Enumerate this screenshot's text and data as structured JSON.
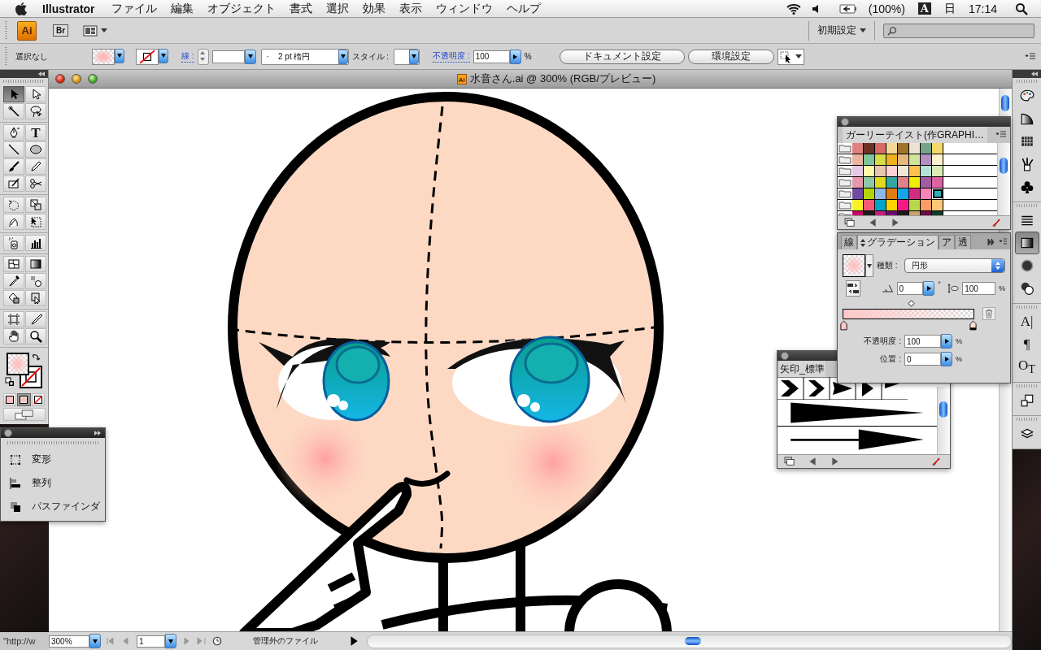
{
  "menu_bar": {
    "app_name": "Illustrator",
    "menus": [
      "ファイル",
      "編集",
      "オブジェクト",
      "書式",
      "選択",
      "効果",
      "表示",
      "ウィンドウ",
      "ヘルプ"
    ],
    "battery": "(100%)",
    "input_source": "A",
    "day": "日",
    "time": "17:14"
  },
  "app_bar": {
    "app_logo": "Ai",
    "bridge_logo": "Br",
    "workspace": "初期設定"
  },
  "control_bar": {
    "selection": "選択なし",
    "stroke_label": "線 :",
    "stroke_profile": "·    2 pt 楕円",
    "style_label": "スタイル :",
    "opacity_label": "不透明度 :",
    "opacity": "100",
    "opacity_unit": "%",
    "buttons": [
      "ドキュメント設定",
      "環境設定"
    ]
  },
  "document": {
    "title": "水音さん.ai @ 300% (RGB/プレビュー)",
    "file_icon": "Ai"
  },
  "tool_groups": [
    {
      "tools": [
        {
          "kind": "selection",
          "selected": true
        },
        {
          "kind": "direct-selection",
          "selected": false
        },
        {
          "kind": "magic-wand",
          "selected": false
        },
        {
          "kind": "lasso",
          "selected": false
        }
      ]
    },
    {
      "tools": [
        {
          "kind": "pen",
          "selected": false
        },
        {
          "kind": "type",
          "glyph": "T",
          "selected": false
        },
        {
          "kind": "line",
          "selected": false
        },
        {
          "kind": "ellipse",
          "selected": false
        },
        {
          "kind": "paintbrush",
          "selected": false
        },
        {
          "kind": "pencil",
          "selected": false
        },
        {
          "kind": "eraser",
          "selected": false
        },
        {
          "kind": "scissors",
          "selected": false
        }
      ]
    },
    {
      "tools": [
        {
          "kind": "rotate",
          "selected": false
        },
        {
          "kind": "scale",
          "selected": false
        },
        {
          "kind": "warp",
          "selected": false
        },
        {
          "kind": "free-transform",
          "selected": false
        }
      ]
    },
    {
      "tools": [
        {
          "kind": "sprayer",
          "selected": false
        },
        {
          "kind": "graph",
          "selected": false
        }
      ]
    },
    {
      "tools": [
        {
          "kind": "mesh",
          "selected": false
        },
        {
          "kind": "gradient",
          "selected": false
        },
        {
          "kind": "eyedropper",
          "selected": false
        },
        {
          "kind": "blend",
          "selected": false
        },
        {
          "kind": "live-paint",
          "selected": false
        },
        {
          "kind": "live-paint-select",
          "selected": false
        }
      ]
    },
    {
      "tools": [
        {
          "kind": "crop",
          "selected": false
        },
        {
          "kind": "slice",
          "selected": false
        },
        {
          "kind": "hand",
          "selected": false
        },
        {
          "kind": "zoom",
          "selected": false
        }
      ]
    }
  ],
  "color_modes": [
    {
      "kind": "color",
      "selected": false
    },
    {
      "kind": "gradient",
      "selected": true
    },
    {
      "kind": "none",
      "selected": false
    }
  ],
  "dock_groups": [
    {
      "icons": [
        {
          "kind": "color",
          "selected": false
        },
        {
          "kind": "color-guide",
          "selected": false
        },
        {
          "kind": "swatches",
          "selected": false
        },
        {
          "kind": "brushes",
          "selected": false
        },
        {
          "kind": "symbols",
          "selected": false
        }
      ]
    },
    {
      "icons": [
        {
          "kind": "stroke",
          "selected": false
        },
        {
          "kind": "gradient",
          "selected": true
        },
        {
          "kind": "transparency",
          "selected": false
        },
        {
          "kind": "appearance",
          "selected": false
        }
      ]
    },
    {
      "icons": [
        {
          "kind": "character",
          "glyph": "A|",
          "selected": false
        },
        {
          "kind": "paragraph",
          "glyph": "¶",
          "selected": false
        },
        {
          "kind": "opentype",
          "glyph": "O$_{T}$",
          "selected": false
        }
      ]
    },
    {
      "icons": [
        {
          "kind": "transform",
          "selected": false
        }
      ]
    },
    {
      "icons": [
        {
          "kind": "layers",
          "selected": false
        }
      ]
    }
  ],
  "swatches_panel": {
    "title": "ガーリーテイスト(作GRAPHI…",
    "rows": [
      {
        "swatches": [
          {
            "color": "#e08080",
            "selected": false
          },
          {
            "color": "#6b3326",
            "selected": false
          },
          {
            "color": "#d96868",
            "selected": false
          },
          {
            "color": "#f5d89a",
            "selected": false
          },
          {
            "color": "#a07428",
            "selected": false
          },
          {
            "color": "#ede3d3",
            "selected": false
          },
          {
            "color": "#76a38a",
            "selected": false
          },
          {
            "color": "#f5d86a",
            "selected": false
          }
        ]
      },
      {
        "swatches": [
          {
            "color": "#e8b4a0",
            "selected": false
          },
          {
            "color": "#80c49a",
            "selected": false
          },
          {
            "color": "#d6dc46",
            "selected": false
          },
          {
            "color": "#ecb21e",
            "selected": false
          },
          {
            "color": "#e6b87e",
            "selected": false
          },
          {
            "color": "#d2e39c",
            "selected": false
          },
          {
            "color": "#b48ec0",
            "selected": false
          },
          {
            "color": "#fff3cc",
            "selected": false
          }
        ]
      },
      {
        "swatches": [
          {
            "color": "#e6c8e4",
            "selected": false
          },
          {
            "color": "#fffaa8",
            "selected": false
          },
          {
            "color": "#e6c6ae",
            "selected": false
          },
          {
            "color": "#ffd0d4",
            "selected": false
          },
          {
            "color": "#f2e6d6",
            "selected": false
          },
          {
            "color": "#ffc04e",
            "selected": false
          },
          {
            "color": "#b6e2d6",
            "selected": false
          },
          {
            "color": "#dcecb4",
            "selected": false
          }
        ]
      },
      {
        "swatches": [
          {
            "color": "#e29aaa",
            "selected": false
          },
          {
            "color": "#8ec8a6",
            "selected": false
          },
          {
            "color": "#e0dc1c",
            "selected": false
          },
          {
            "color": "#2ea8a0",
            "selected": false
          },
          {
            "color": "#e08088",
            "selected": false
          },
          {
            "color": "#f0ec0c",
            "selected": false
          },
          {
            "color": "#a05ea2",
            "selected": false
          },
          {
            "color": "#dc64a0",
            "selected": false
          }
        ]
      },
      {
        "swatches": [
          {
            "color": "#6e4ca0",
            "selected": false
          },
          {
            "color": "#b4d400",
            "selected": false
          },
          {
            "color": "#8cb8e8",
            "selected": false
          },
          {
            "color": "#e07c10",
            "selected": false
          },
          {
            "color": "#14a4e8",
            "selected": false
          },
          {
            "color": "#d42c84",
            "selected": false
          },
          {
            "color": "#fc84b8",
            "selected": false
          },
          {
            "color": "#30b0b8",
            "selected": true
          }
        ]
      },
      {
        "swatches": [
          {
            "color": "#f8f028",
            "selected": false
          },
          {
            "color": "#f85878",
            "selected": false
          },
          {
            "color": "#00a4c8",
            "selected": false
          },
          {
            "color": "#fcd400",
            "selected": false
          },
          {
            "color": "#f41c84",
            "selected": false
          },
          {
            "color": "#b8d84c",
            "selected": false
          },
          {
            "color": "#fc9c64",
            "selected": false
          },
          {
            "color": "#fcc878",
            "selected": false
          }
        ]
      },
      {
        "swatches": [
          {
            "color": "#c8006c",
            "selected": false
          },
          {
            "color": "#1c1c1c",
            "selected": false
          },
          {
            "color": "#c81c7c",
            "selected": false
          },
          {
            "color": "#6c0870",
            "selected": false
          },
          {
            "color": "#1c1c1c",
            "selected": false
          },
          {
            "color": "#c8a46c",
            "selected": false
          },
          {
            "color": "#6c0c44",
            "selected": false
          },
          {
            "color": "#0c3c2c",
            "selected": false
          }
        ]
      }
    ]
  },
  "gradient_panel": {
    "tabs": [
      {
        "label": "線",
        "selected": false
      },
      {
        "label": "グラデーション",
        "selected": true
      },
      {
        "label": "ア",
        "selected": false
      },
      {
        "label": "透",
        "selected": false
      }
    ],
    "type_label": "種類 :",
    "type": "円形",
    "angle": "0",
    "angle_unit": "°",
    "aspect": "100",
    "aspect_unit": "%",
    "opacity_label": "不透明度 :",
    "opacity": "100",
    "opacity_unit": "%",
    "stops": [
      {
        "color": "#ffc8c8",
        "selected": false
      },
      {
        "color": "#ffe0d4",
        "selected": true
      }
    ],
    "location_label": "位置 :",
    "location": "0",
    "location_unit": "%"
  },
  "arrow_panel": {
    "title": "矢印_標準"
  },
  "transform_dock": {
    "items": [
      {
        "kind": "transform",
        "label": "変形"
      },
      {
        "kind": "align",
        "label": "整列"
      },
      {
        "kind": "pathfinder",
        "label": "パスファインダ"
      }
    ]
  },
  "status_bar": {
    "url": "\"http://w",
    "zoom": "300%",
    "page": "1",
    "info": "管理外のファイル"
  }
}
